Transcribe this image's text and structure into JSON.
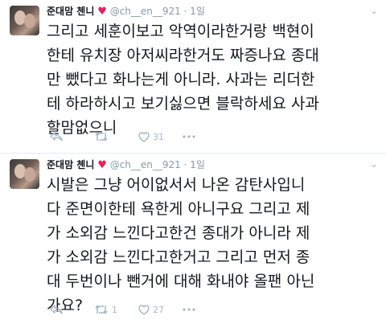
{
  "tweets": [
    {
      "name": "준대맘 첸니",
      "heart": "♥",
      "handle": "@ch__en__921",
      "dot": "·",
      "time": "1일",
      "text": "그리고 세훈이보고 악역이라한거랑 백현이\n한테 유치장 아저씨라한거도 짜증나요 종대\n만 뺐다고 화나는게 아니라. 사과는 리더한\n테 하라하시고 보기싫으면 블락하세요 사과\n할맘없으니",
      "retweets": "",
      "likes": "31"
    },
    {
      "name": "준대맘 첸니",
      "heart": "♥",
      "handle": "@ch__en__921",
      "dot": "·",
      "time": "1일",
      "text": "시발은 그냥 어이없서서 나온 감탄사입니\n다 준면이한테 욕한게 아니구요 그리고 제\n가 소외감 느낀다고한건 종대가 아니라 제\n가 소외감 느낀다고한거고 그리고 먼저 종\n대 두번이나 뺀거에 대해 화내야 올팬 아닌\n가요?",
      "retweets": "1",
      "likes": "27"
    }
  ],
  "icons": {
    "reply": "reply-icon",
    "retweet": "retweet-icon",
    "like": "heart-icon",
    "more": "more-dots-icon",
    "chevron": "chevron-down-icon"
  },
  "colors": {
    "heart": "#e0245e",
    "muted": "#8899a6",
    "icon": "#aab8c2",
    "divider": "#e6ecf0"
  }
}
